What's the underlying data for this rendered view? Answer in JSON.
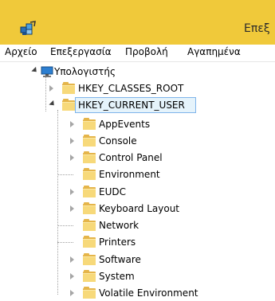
{
  "window": {
    "title": "Επεξ"
  },
  "menu": [
    {
      "label": "Αρχείο"
    },
    {
      "label": "Επεξεργασία"
    },
    {
      "label": "Προβολή"
    },
    {
      "label": "Αγαπημένα"
    }
  ],
  "tree": {
    "root": {
      "label": "Υπολογιστής",
      "expanded": true,
      "icon": "computer-icon"
    },
    "hives": [
      {
        "label": "HKEY_CLASSES_ROOT",
        "expanded": false
      },
      {
        "label": "HKEY_CURRENT_USER",
        "expanded": true,
        "selected": true
      }
    ],
    "children": [
      {
        "label": "AppEvents",
        "has_children": true
      },
      {
        "label": "Console",
        "has_children": true
      },
      {
        "label": "Control Panel",
        "has_children": true
      },
      {
        "label": "Environment",
        "has_children": false
      },
      {
        "label": "EUDC",
        "has_children": true
      },
      {
        "label": "Keyboard Layout",
        "has_children": true
      },
      {
        "label": "Network",
        "has_children": false
      },
      {
        "label": "Printers",
        "has_children": false
      },
      {
        "label": "Software",
        "has_children": true
      },
      {
        "label": "System",
        "has_children": true
      },
      {
        "label": "Volatile Environment",
        "has_children": true
      }
    ]
  },
  "colors": {
    "titlebar": "#f0c93a",
    "selection_border": "#7eb4ea",
    "selection_fill": "#e5f3fb",
    "folder": "#f7d97a"
  }
}
